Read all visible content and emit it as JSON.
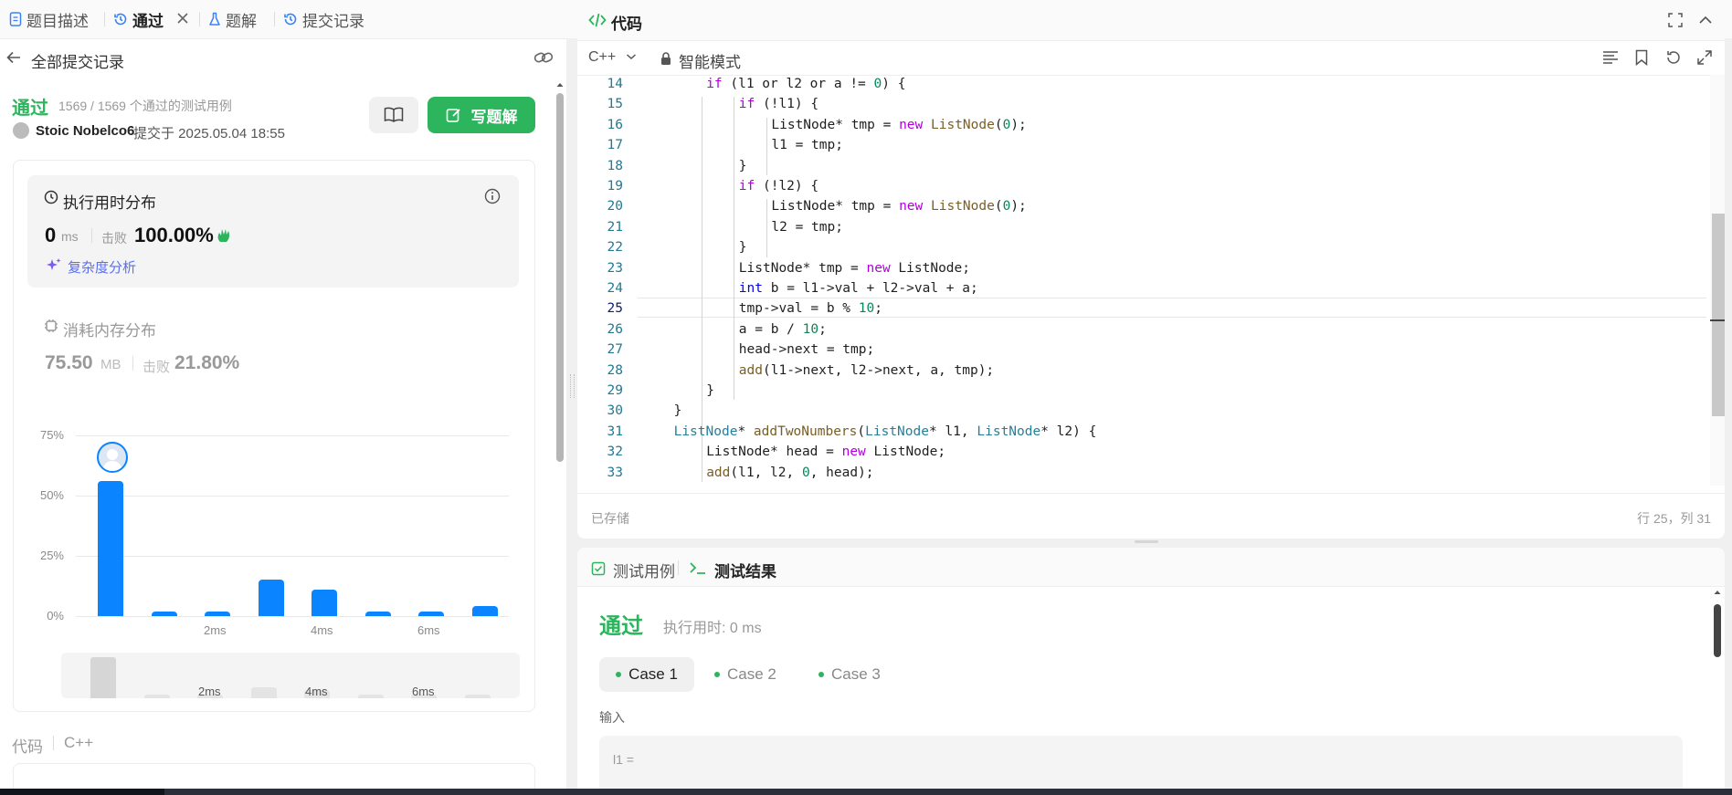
{
  "tabs": [
    {
      "label": "题目描述",
      "icon": "document-icon"
    },
    {
      "label": "通过",
      "icon": "history-icon"
    },
    {
      "label": "题解",
      "icon": "flask-icon"
    },
    {
      "label": "提交记录",
      "icon": "history-icon"
    }
  ],
  "back_label": "全部提交记录",
  "submission": {
    "status": "通过",
    "passed_tests": "1569 / 1569 个通过的测试用例",
    "user": "Stoic Nobelco6",
    "submitted_at": "提交于 2025.05.04 18:55",
    "write_solution": "写题解"
  },
  "runtime": {
    "title": "执行用时分布",
    "value": "0",
    "unit": "ms",
    "beats_label": "击败",
    "beats": "100.00%",
    "complexity": "复杂度分析"
  },
  "memory": {
    "title": "消耗内存分布",
    "value": "75.50",
    "unit": "MB",
    "beats_label": "击败",
    "beats": "21.80%"
  },
  "chart_data": {
    "type": "bar",
    "title": "",
    "xlabel": "",
    "ylabel": "",
    "x_tick_labels": [
      "2ms",
      "4ms",
      "6ms"
    ],
    "y_tick_labels": [
      "75%",
      "50%",
      "25%",
      "0%"
    ],
    "ylim": [
      0,
      75
    ],
    "values": [
      56,
      2,
      2,
      15,
      11,
      2,
      2,
      4
    ],
    "highlighted_index": 0,
    "grid": true,
    "color": "#0a84ff"
  },
  "code_footer": {
    "label": "代码",
    "lang": "C++"
  },
  "editor": {
    "title": "代码",
    "language": "C++",
    "mode": "智能模式",
    "saved": "已存储",
    "cursor": "行 25，列 31",
    "lines": [
      {
        "n": "14",
        "indent": 2,
        "tokens": [
          [
            "if",
            "kw"
          ],
          [
            " (l1 or l2 or a != ",
            ""
          ],
          [
            "0",
            "nu"
          ],
          [
            ") {",
            ""
          ]
        ]
      },
      {
        "n": "15",
        "indent": 3,
        "tokens": [
          [
            "if",
            "kw"
          ],
          [
            " (!l1) {",
            ""
          ]
        ]
      },
      {
        "n": "16",
        "indent": 4,
        "tokens": [
          [
            "ListNode* tmp = ",
            ""
          ],
          [
            "new",
            "kw"
          ],
          [
            " ",
            ""
          ],
          [
            "ListNode",
            "fn"
          ],
          [
            "(",
            ""
          ],
          [
            "0",
            "nu"
          ],
          [
            ");",
            ""
          ]
        ]
      },
      {
        "n": "17",
        "indent": 4,
        "tokens": [
          [
            "l1 = tmp;",
            ""
          ]
        ]
      },
      {
        "n": "18",
        "indent": 3,
        "tokens": [
          [
            "}",
            ""
          ]
        ]
      },
      {
        "n": "19",
        "indent": 3,
        "tokens": [
          [
            "if",
            "kw"
          ],
          [
            " (!l2) {",
            ""
          ]
        ]
      },
      {
        "n": "20",
        "indent": 4,
        "tokens": [
          [
            "ListNode* tmp = ",
            ""
          ],
          [
            "new",
            "kw"
          ],
          [
            " ",
            ""
          ],
          [
            "ListNode",
            "fn"
          ],
          [
            "(",
            ""
          ],
          [
            "0",
            "nu"
          ],
          [
            ");",
            ""
          ]
        ]
      },
      {
        "n": "21",
        "indent": 4,
        "tokens": [
          [
            "l2 = tmp;",
            ""
          ]
        ]
      },
      {
        "n": "22",
        "indent": 3,
        "tokens": [
          [
            "}",
            ""
          ]
        ]
      },
      {
        "n": "23",
        "indent": 3,
        "tokens": [
          [
            "ListNode* tmp = ",
            ""
          ],
          [
            "new",
            "kw"
          ],
          [
            " ListNode;",
            ""
          ]
        ]
      },
      {
        "n": "24",
        "indent": 3,
        "tokens": [
          [
            "int",
            "kw2"
          ],
          [
            " b = l1->val + l2->val + a;",
            ""
          ]
        ]
      },
      {
        "n": "25",
        "indent": 3,
        "tokens": [
          [
            "tmp->val = b % ",
            ""
          ],
          [
            "10",
            "nu"
          ],
          [
            ";",
            ""
          ]
        ]
      },
      {
        "n": "26",
        "indent": 3,
        "tokens": [
          [
            "a = b / ",
            ""
          ],
          [
            "10",
            "nu"
          ],
          [
            ";",
            ""
          ]
        ]
      },
      {
        "n": "27",
        "indent": 3,
        "tokens": [
          [
            "head->next = tmp;",
            ""
          ]
        ]
      },
      {
        "n": "28",
        "indent": 3,
        "tokens": [
          [
            "add",
            "fn"
          ],
          [
            "(l1->next, l2->next, a, tmp);",
            ""
          ]
        ]
      },
      {
        "n": "29",
        "indent": 2,
        "tokens": [
          [
            "}",
            ""
          ]
        ]
      },
      {
        "n": "30",
        "indent": 1,
        "tokens": [
          [
            "}",
            ""
          ]
        ]
      },
      {
        "n": "31",
        "indent": 1,
        "tokens": [
          [
            "ListNode",
            "ty"
          ],
          [
            "* ",
            ""
          ],
          [
            "addTwoNumbers",
            "fn"
          ],
          [
            "(",
            ""
          ],
          [
            "ListNode",
            "ty"
          ],
          [
            "* l1, ",
            ""
          ],
          [
            "ListNode",
            "ty"
          ],
          [
            "* l2) {",
            ""
          ]
        ]
      },
      {
        "n": "32",
        "indent": 2,
        "tokens": [
          [
            "ListNode* head = ",
            ""
          ],
          [
            "new",
            "kw"
          ],
          [
            " ListNode;",
            ""
          ]
        ]
      },
      {
        "n": "33",
        "indent": 2,
        "tokens": [
          [
            "add",
            "fn"
          ],
          [
            "(l1, l2, ",
            ""
          ],
          [
            "0",
            "nu"
          ],
          [
            ", head);",
            ""
          ]
        ]
      }
    ]
  },
  "result": {
    "tab_testcase": "测试用例",
    "tab_result": "测试结果",
    "status": "通过",
    "runtime": "执行用时: 0 ms",
    "cases": [
      "Case 1",
      "Case 2",
      "Case 3"
    ],
    "input_label": "输入",
    "input_first": "l1 ="
  }
}
